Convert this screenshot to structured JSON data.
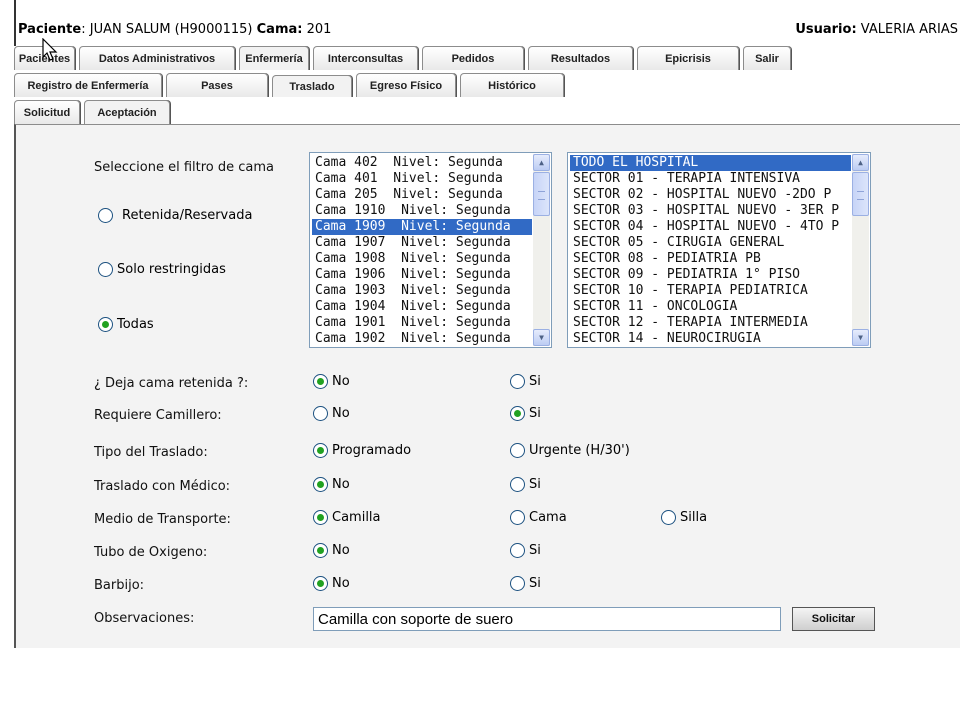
{
  "header": {
    "patient_label": "Paciente",
    "patient_value": ": JUAN SALUM  (H9000115) ",
    "bed_label": "Cama:",
    "bed_value": " 201",
    "user_label": "Usuario:",
    "user_value": " VALERIA ARIAS"
  },
  "tabs_main": [
    "Pacientes",
    "Datos Administrativos",
    "Enfermería",
    "Interconsultas",
    "Pedidos",
    "Resultados",
    "Epicrisis",
    "Salir"
  ],
  "tabs_sub": [
    "Registro de Enfermería",
    "Pases",
    "Traslado",
    "Egreso Físico",
    "Histórico"
  ],
  "tabs_sub2": [
    "Solicitud",
    "Aceptación"
  ],
  "filter": {
    "label": "Seleccione el filtro de cama",
    "options": [
      "Retenida/Reservada",
      "Solo restringidas",
      "Todas"
    ],
    "selected": "Todas"
  },
  "bed_list": {
    "items": [
      "Cama 402  Nivel: Segunda",
      "Cama 401  Nivel: Segunda",
      "Cama 205  Nivel: Segunda",
      "Cama 1910  Nivel: Segunda",
      "Cama 1909  Nivel: Segunda",
      "Cama 1907  Nivel: Segunda",
      "Cama 1908  Nivel: Segunda",
      "Cama 1906  Nivel: Segunda",
      "Cama 1903  Nivel: Segunda",
      "Cama 1904  Nivel: Segunda",
      "Cama 1901  Nivel: Segunda",
      "Cama 1902  Nivel: Segunda"
    ],
    "selected_index": 4
  },
  "sector_list": {
    "items": [
      "TODO EL HOSPITAL",
      "SECTOR 01 - TERAPIA INTENSIVA",
      "SECTOR 02 - HOSPITAL NUEVO -2DO P",
      "SECTOR 03 - HOSPITAL NUEVO - 3ER P",
      "SECTOR 04 - HOSPITAL NUEVO - 4TO P",
      "SECTOR 05 - CIRUGIA GENERAL",
      "SECTOR 08 - PEDIATRIA PB",
      "SECTOR 09 - PEDIATRIA 1° PISO",
      "SECTOR 10 - TERAPIA PEDIATRICA",
      "SECTOR 11 - ONCOLOGIA",
      "SECTOR 12 - TERAPIA INTERMEDIA",
      "SECTOR 14 - NEUROCIRUGIA"
    ],
    "selected_index": 0
  },
  "questions": [
    {
      "label": "¿ Deja cama retenida ?:",
      "options": [
        "No",
        "Si"
      ],
      "selected": "No"
    },
    {
      "label": "Requiere Camillero:",
      "options": [
        "No",
        "Si"
      ],
      "selected": "Si"
    },
    {
      "label": "Tipo del Traslado:",
      "options": [
        "Programado",
        "Urgente (H/30')"
      ],
      "selected": "Programado"
    },
    {
      "label": "Traslado con Médico:",
      "options": [
        "No",
        "Si"
      ],
      "selected": "No"
    },
    {
      "label": "Medio de Transporte:",
      "options": [
        "Camilla",
        "Cama",
        "Silla"
      ],
      "selected": "Camilla"
    },
    {
      "label": "Tubo de Oxigeno:",
      "options": [
        "No",
        "Si"
      ],
      "selected": "No"
    },
    {
      "label": "Barbijo:",
      "options": [
        "No",
        "Si"
      ],
      "selected": "No"
    }
  ],
  "observations": {
    "label": "Observaciones:",
    "value": "Camilla con soporte de suero "
  },
  "submit_label": "Solicitar",
  "colors": {
    "selection": "#316ac5",
    "radio_dot": "#21a121",
    "panel_bg": "#f3f3f3"
  }
}
